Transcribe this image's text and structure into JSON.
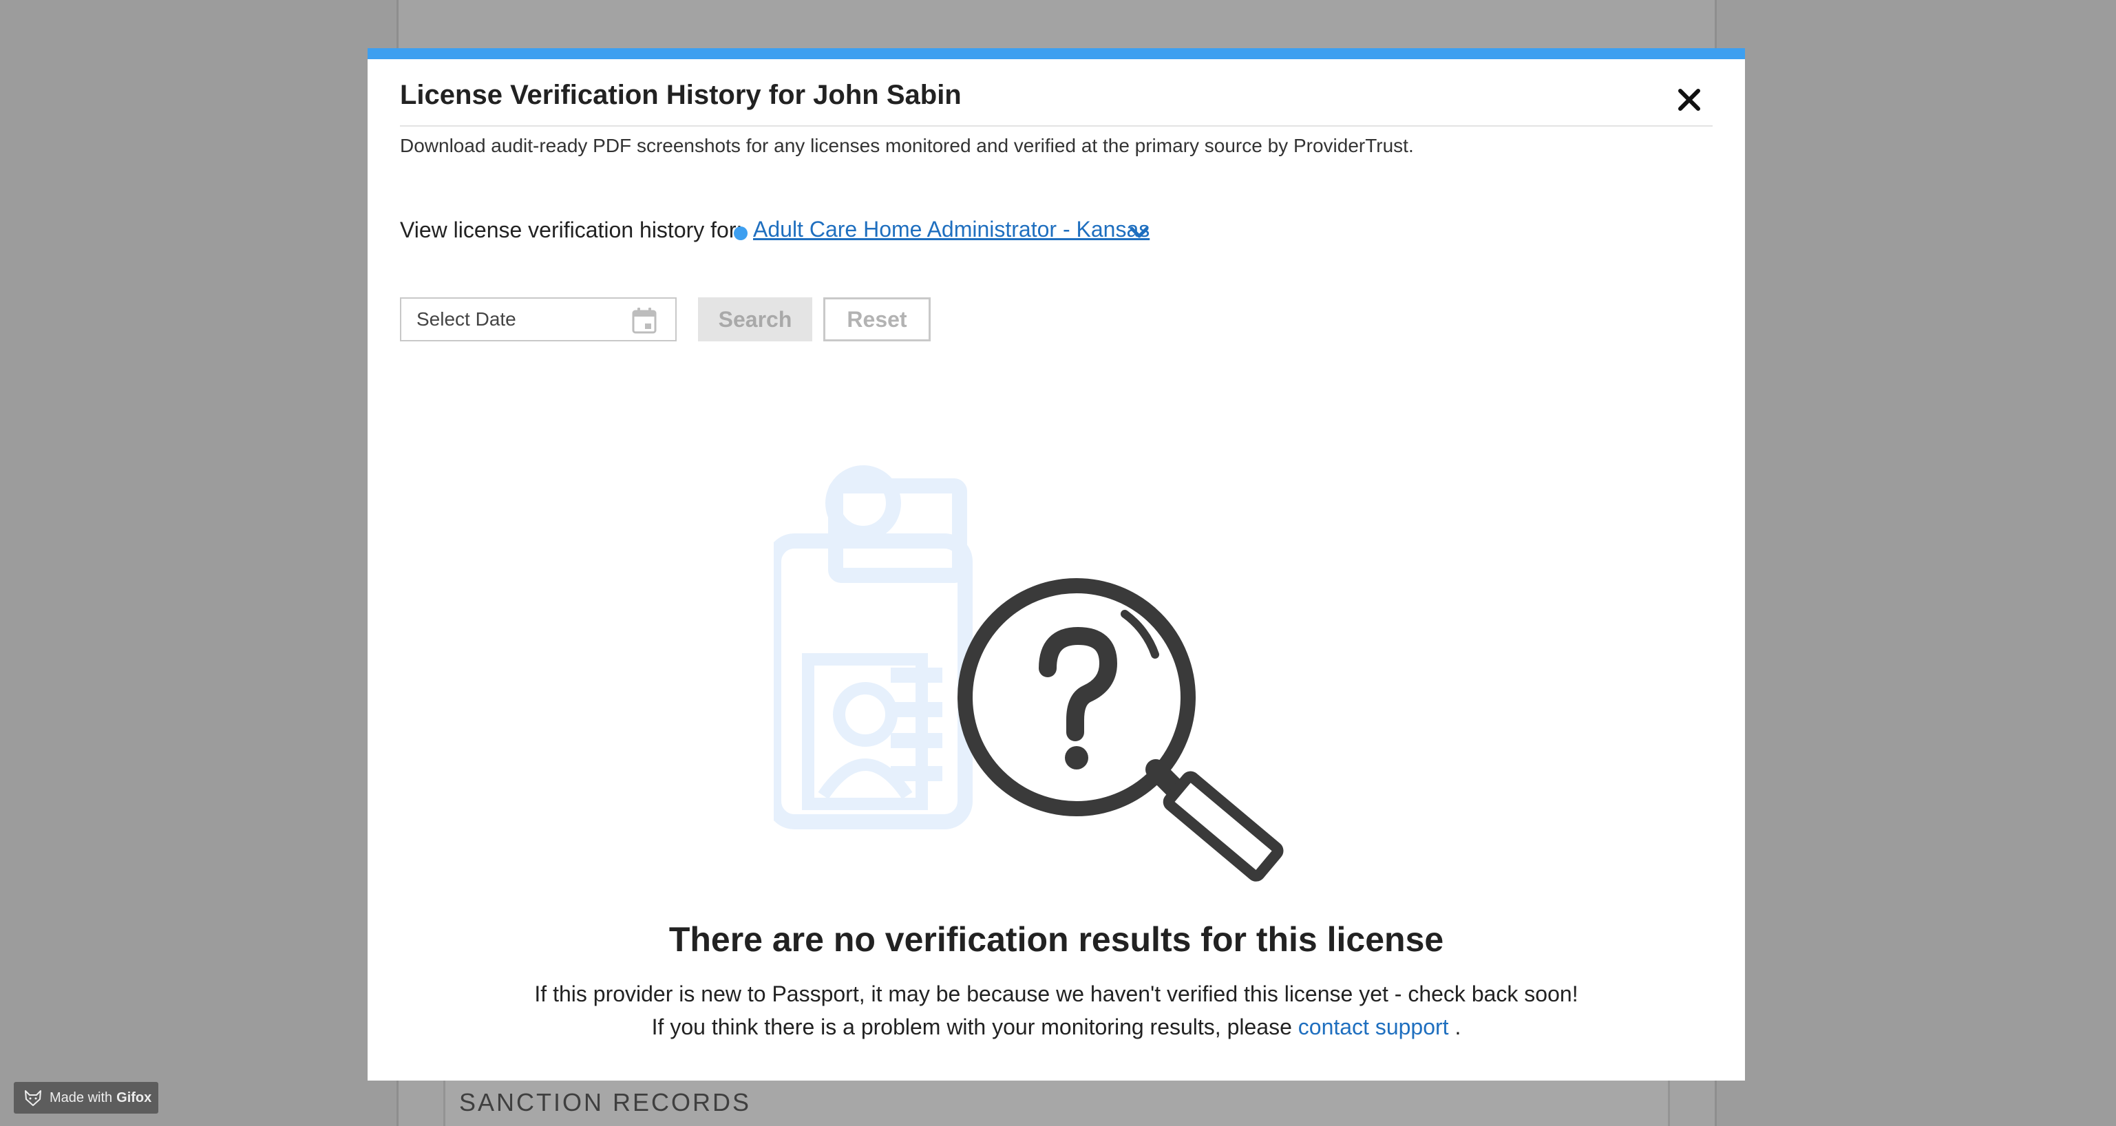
{
  "background": {
    "section_title": "SANCTION RECORDS"
  },
  "modal": {
    "title": "License Verification History for John Sabin",
    "subtitle": "Download audit-ready PDF screenshots for any licenses monitored and verified at the primary source by ProviderTrust.",
    "view_label": "View license verification history for:",
    "license_selected": "Adult Care Home Administrator - Kansas",
    "date_placeholder": "Select Date",
    "search_label": "Search",
    "reset_label": "Reset",
    "empty_heading": "There are no verification results for this license",
    "empty_line1": "If this provider is new to Passport, it may be because we haven't verified this license yet - check back soon!",
    "empty_line2_prefix": "If you think there is a problem with your monitoring results, please",
    "contact_link": "contact support",
    "empty_line2_suffix": "."
  },
  "badge": {
    "made_with": "Made with",
    "brand": "Gifox"
  },
  "colors": {
    "accent": "#3d9ff0",
    "link": "#1f6fbf",
    "illustration_light": "#e6f0fc",
    "illustration_dark": "#3a3a3a"
  },
  "icons": [
    "close-icon",
    "chevron-down-icon",
    "calendar-icon",
    "id-card-icon",
    "magnifier-question-icon",
    "fox-icon"
  ]
}
